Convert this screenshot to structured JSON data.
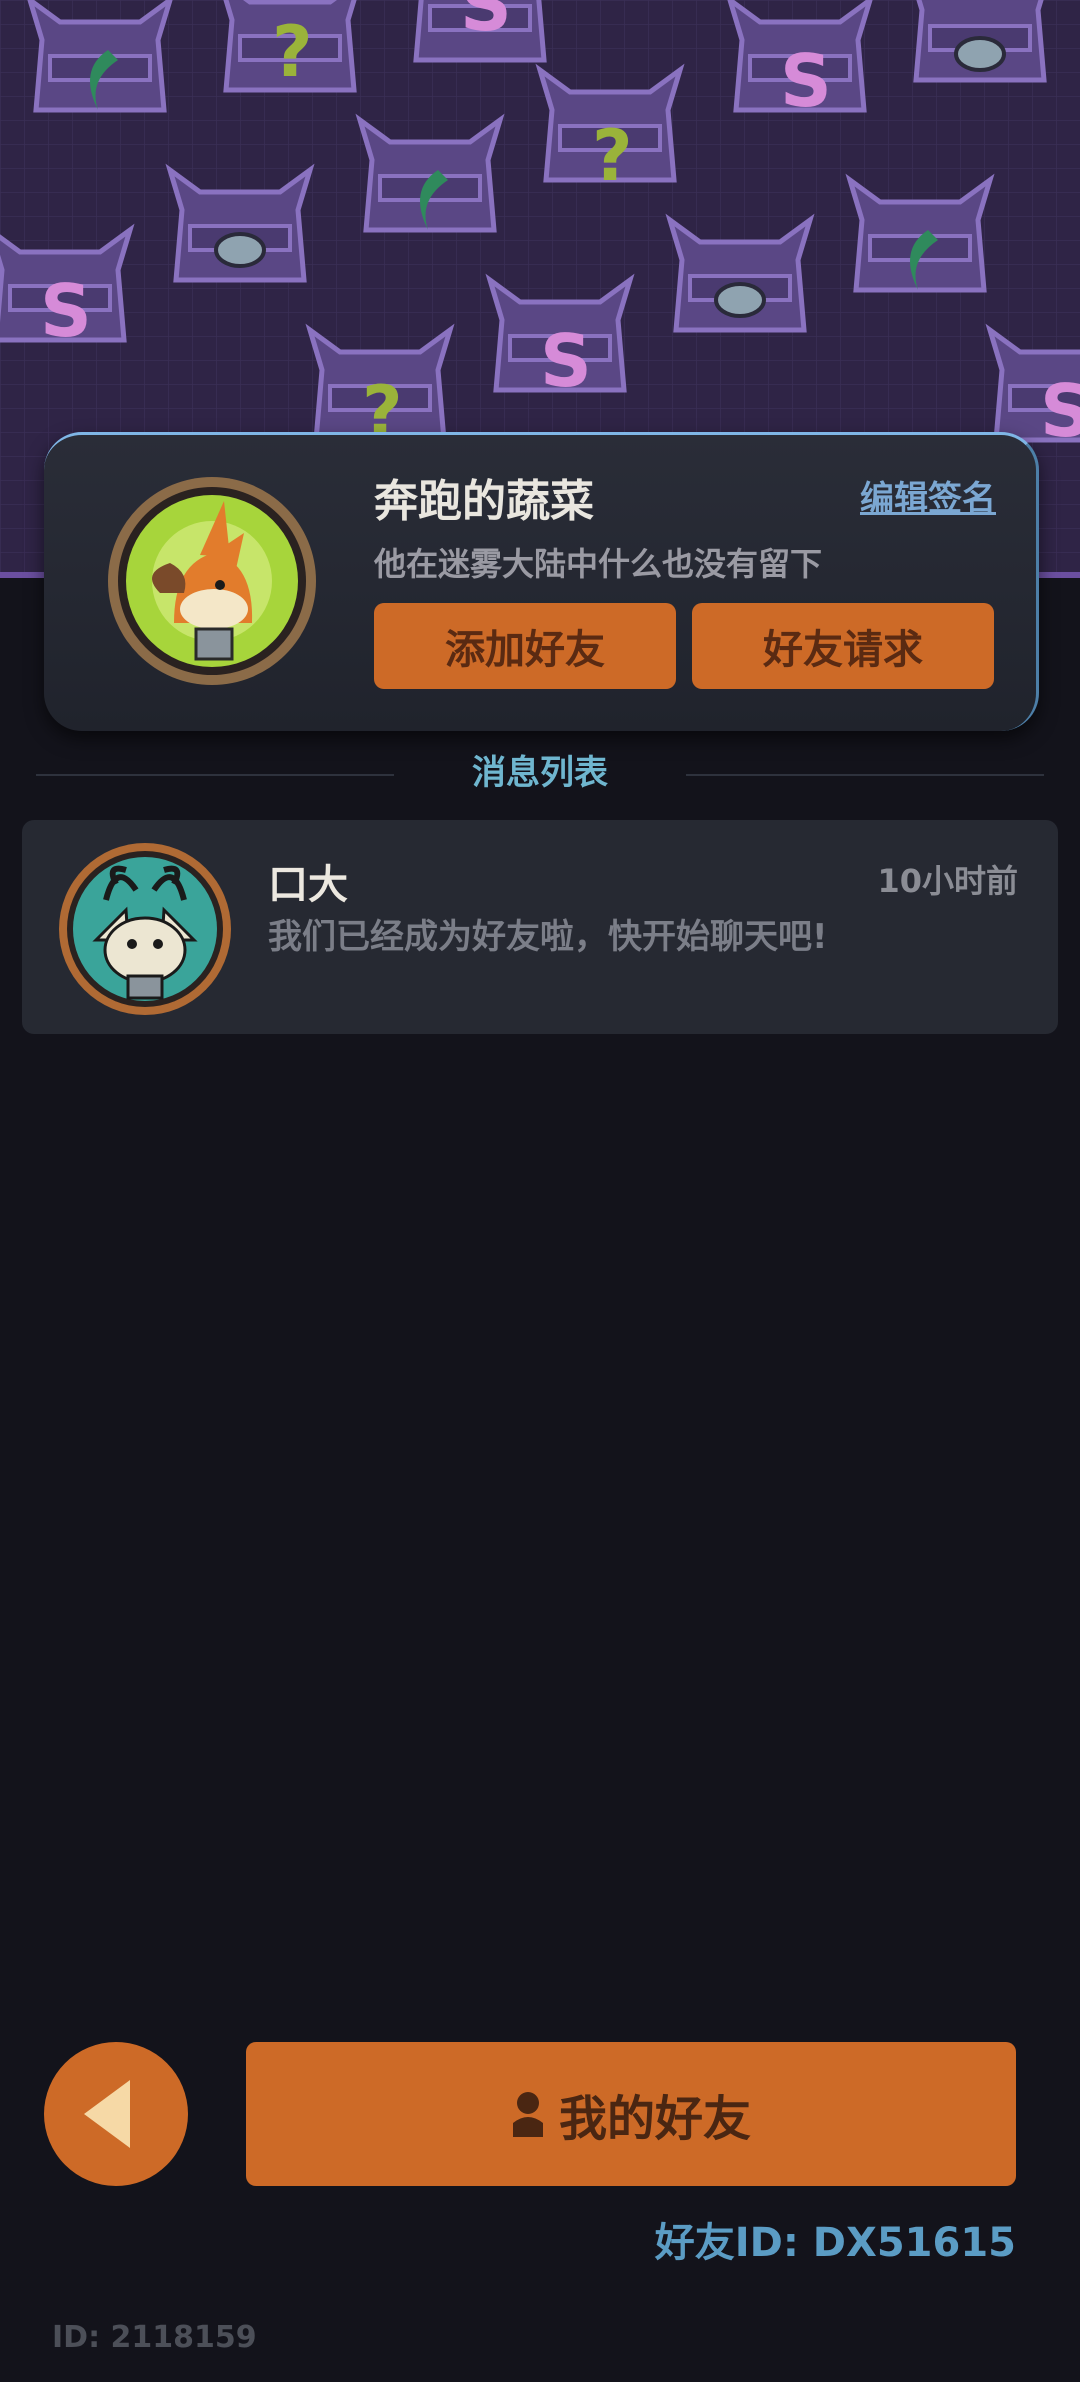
{
  "profile": {
    "name": "奔跑的蔬菜",
    "edit_label": "编辑签名",
    "signature": "他在迷雾大陆中什么也没有留下",
    "add_friend_label": "添加好友",
    "friend_request_label": "好友请求",
    "avatar_icon": "fox-character-avatar"
  },
  "messages": {
    "section_title": "消息列表",
    "items": [
      {
        "name": "口大",
        "time": "10小时前",
        "text": "我们已经成为好友啦，快开始聊天吧!",
        "avatar_icon": "antlered-cat-avatar"
      }
    ]
  },
  "bottom": {
    "back_icon": "back-arrow-icon",
    "my_friends_label": "我的好友",
    "my_friends_icon": "person-icon",
    "friend_id": "好友ID: DX51615",
    "user_id": "ID: 2118159"
  },
  "colors": {
    "accent_orange": "#cd6a27",
    "background": "#13131b",
    "banner_purple": "#2f2446",
    "link_blue": "#7ba7d2",
    "section_cyan": "#6fb6cf"
  }
}
